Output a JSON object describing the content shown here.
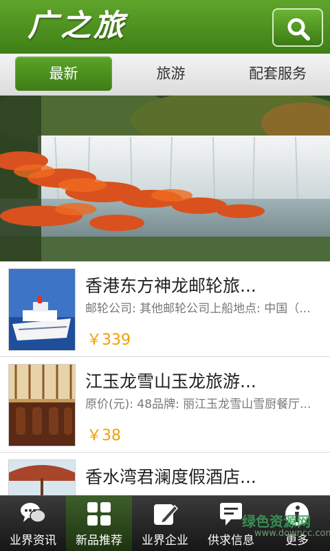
{
  "header": {
    "logo": "广之旅",
    "search_icon": "search-icon"
  },
  "tabs": [
    {
      "label": "最新",
      "active": true
    },
    {
      "label": "旅游",
      "active": false
    },
    {
      "label": "配套服务",
      "active": false
    }
  ],
  "banner": {
    "slide_count": 5,
    "active_slide": 2
  },
  "items": [
    {
      "title": "香港东方神龙邮轮旅...",
      "desc": "邮轮公司: 其他邮轮公司上船地点: 中国（...",
      "price": "￥339"
    },
    {
      "title": "江玉龙雪山玉龙旅游...",
      "desc": "原价(元): 48品牌: 丽江玉龙雪山雪厨餐厅...",
      "price": "￥38"
    },
    {
      "title": "香水湾君澜度假酒店...",
      "desc": "",
      "price": ""
    }
  ],
  "nav": [
    {
      "label": "业界资讯",
      "icon": "chat-bubbles-icon",
      "active": false
    },
    {
      "label": "新品推荐",
      "icon": "grid-icon",
      "active": true
    },
    {
      "label": "业界企业",
      "icon": "edit-icon",
      "active": false
    },
    {
      "label": "供求信息",
      "icon": "message-icon",
      "active": false
    },
    {
      "label": "更多",
      "icon": "info-icon",
      "active": false
    }
  ],
  "watermark": {
    "text": "绿色资源网",
    "url": "www.downcc.com"
  },
  "colors": {
    "brand_green": "#4a8f1f",
    "price_orange": "#f2a000",
    "dot_active": "#f0b500"
  }
}
